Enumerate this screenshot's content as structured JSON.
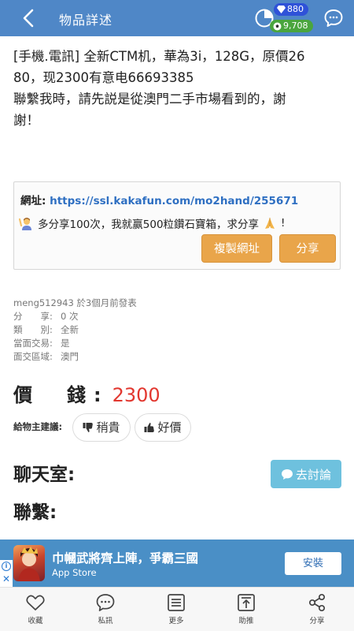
{
  "header": {
    "title": "物品詳述",
    "diamond_count": "880",
    "coin_count": "9,708"
  },
  "post": {
    "lines": [
      "[手機.電訊] 全新CTM机，華為3i，128G，原價26",
      "80，现2300有意电66693385",
      "聯繫我時，請先説是從澳門二手市場看到的，謝",
      "謝！"
    ]
  },
  "share": {
    "url_label": "網址: ",
    "url": "https://ssl.kakafun.com/mo2hand/255671",
    "promo_text": "多分享100次，我就赢500粒鑽石寶箱，求分享",
    "promo_suffix": "!",
    "copy_button": "複製網址",
    "share_button": "分享"
  },
  "meta": {
    "poster_line": "meng512943 於3個月前發表",
    "rows": [
      {
        "key": "分　　享:",
        "value": "0 次"
      },
      {
        "key": "類　　別:",
        "value": "全新"
      },
      {
        "key": "當面交易:",
        "value": "是"
      },
      {
        "key": "面交區域:",
        "value": "澳門"
      }
    ]
  },
  "price": {
    "label": "價　錢:",
    "value": "2300"
  },
  "suggest": {
    "label": "給物主建議:",
    "expensive": "稍貴",
    "good_price": "好價"
  },
  "chat": {
    "title": "聊天室:",
    "discuss_button": "去討論",
    "contact_title": "聯繫:"
  },
  "ad": {
    "title": "巾幗武將齊上陣，爭霸三國",
    "subtitle": "App Store",
    "install_button": "安裝"
  },
  "nav": [
    {
      "label": "收藏",
      "icon": "heart-icon"
    },
    {
      "label": "私訊",
      "icon": "message-bubble-icon"
    },
    {
      "label": "更多",
      "icon": "list-icon"
    },
    {
      "label": "助推",
      "icon": "push-up-icon"
    },
    {
      "label": "分享",
      "icon": "share-icon"
    }
  ],
  "colors": {
    "header": "#4f87c7",
    "price": "#e2372f",
    "accent_button": "#e9a54a",
    "discuss_button": "#6ec1de",
    "ad_banner": "#4a8fc6",
    "link": "#2e6fc2"
  }
}
